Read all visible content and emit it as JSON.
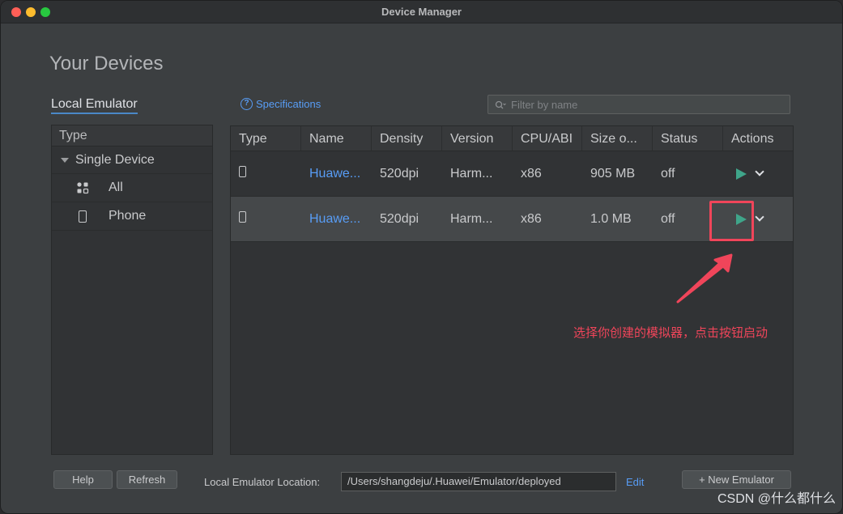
{
  "window": {
    "title": "Device Manager"
  },
  "page": {
    "heading": "Your Devices"
  },
  "tabs": {
    "local_emulator": "Local Emulator"
  },
  "specifications_link": "Specifications",
  "filter": {
    "placeholder": "Filter by name"
  },
  "left_panel": {
    "header": "Type",
    "group": "Single Device",
    "items": [
      {
        "label": "All",
        "icon": "grid-icon"
      },
      {
        "label": "Phone",
        "icon": "phone-icon"
      }
    ]
  },
  "table": {
    "columns": [
      "Type",
      "Name",
      "Density",
      "Version",
      "CPU/ABI",
      "Size o...",
      "Status",
      "Actions"
    ],
    "rows": [
      {
        "type_icon": "phone-icon",
        "name": "Huawe...",
        "density": "520dpi",
        "version": "Harm...",
        "cpu": "x86",
        "size": "905 MB",
        "status": "off"
      },
      {
        "type_icon": "phone-icon",
        "name": "Huawe...",
        "density": "520dpi",
        "version": "Harm...",
        "cpu": "x86",
        "size": "1.0 MB",
        "status": "off"
      }
    ]
  },
  "annotation": "选择你创建的模拟器，点击按钮启动",
  "bottom": {
    "help": "Help",
    "refresh": "Refresh",
    "location_label": "Local Emulator Location:",
    "location_value": "/Users/shangdeju/.Huawei/Emulator/deployed",
    "edit": "Edit",
    "new_emulator": "+ New Emulator"
  },
  "watermark": "CSDN @什么都什么",
  "colors": {
    "accent_link": "#589df6",
    "play": "#3fa58a",
    "annotation": "#f0455a"
  }
}
